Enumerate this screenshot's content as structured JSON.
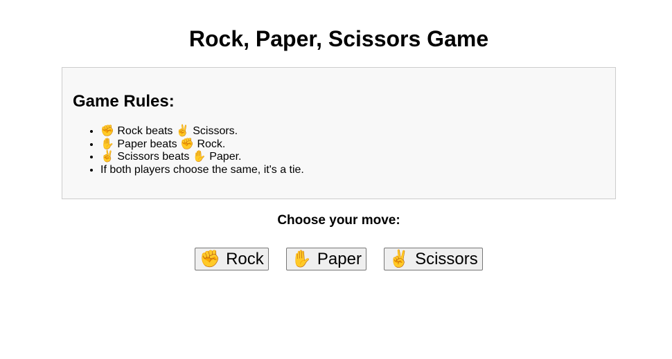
{
  "title": "Rock, Paper, Scissors Game",
  "rules": {
    "heading": "Game Rules:",
    "items": [
      {
        "icon_a": "✊",
        "text_a": " Rock beats ",
        "icon_b": "✌️",
        "text_b": " Scissors."
      },
      {
        "icon_a": "✋",
        "text_a": " Paper beats ",
        "icon_b": "✊",
        "text_b": " Rock."
      },
      {
        "icon_a": "✌️",
        "text_a": " Scissors beats ",
        "icon_b": "✋",
        "text_b": " Paper."
      }
    ],
    "tie_rule": "If both players choose the same, it's a tie."
  },
  "prompt": "Choose your move:",
  "moves": [
    {
      "icon": "✊",
      "label": "Rock"
    },
    {
      "icon": "✋",
      "label": "Paper"
    },
    {
      "icon": "✌️",
      "label": "Scissors"
    }
  ]
}
